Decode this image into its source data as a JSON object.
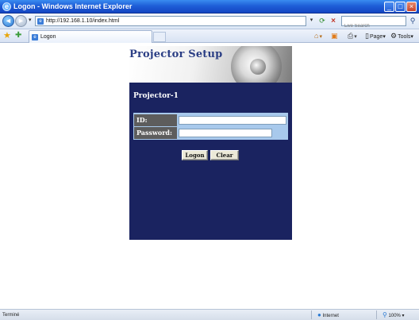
{
  "window": {
    "title": "Logon - Windows Internet Explorer",
    "min_glyph": "_",
    "max_glyph": "□",
    "close_glyph": "×"
  },
  "addressbar": {
    "url": "http://192.168.1.10/index.html",
    "search_placeholder": "Live Search"
  },
  "tabbar": {
    "tab_label": "Logon",
    "commands": {
      "page": "Page",
      "tools": "Tools"
    }
  },
  "page": {
    "header_title": "Projector Setup",
    "device_name": "Projector-1",
    "id_label": "ID:",
    "password_label": "Password:",
    "id_value": "",
    "password_value": "",
    "logon_button": "Logon",
    "clear_button": "Clear",
    "colors": {
      "panel_bg": "#1a2360",
      "form_border": "#a8c9ec",
      "label_bg": "#5d5d5d",
      "title_color": "#2c3f85"
    }
  },
  "statusbar": {
    "status": "Terminé",
    "zone": "Internet",
    "zoom": "100%"
  },
  "icons": [
    "ie-logo-icon",
    "back-arrow-icon",
    "forward-arrow-icon",
    "page-icon",
    "refresh-icon",
    "stop-icon",
    "search-icon",
    "favorites-star-icon",
    "add-favorites-icon",
    "home-icon",
    "feeds-icon",
    "print-icon",
    "globe-icon",
    "zoom-icon"
  ]
}
